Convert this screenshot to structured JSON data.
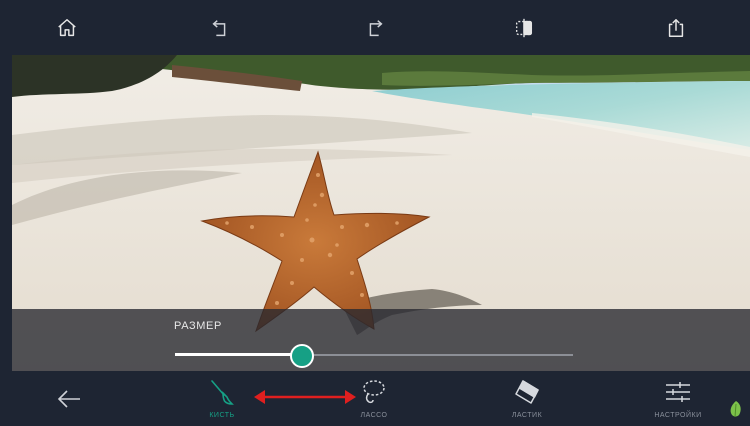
{
  "app": {
    "colors": {
      "background": "#1e2533",
      "accent": "#16a085",
      "arrow": "#e01f1f"
    }
  },
  "toolbar": {
    "buttons": [
      {
        "name": "home",
        "icon": "home-icon"
      },
      {
        "name": "undo",
        "icon": "undo-icon"
      },
      {
        "name": "redo",
        "icon": "redo-icon"
      },
      {
        "name": "compare",
        "icon": "compare-icon"
      },
      {
        "name": "share",
        "icon": "share-icon"
      }
    ]
  },
  "size_panel": {
    "label": "РАЗМЕР",
    "slider_value_percent": 32
  },
  "bottom_bar": {
    "back_icon": "arrow-left-icon",
    "tools": [
      {
        "label": "КИСТЬ",
        "icon": "brush-icon",
        "active": true
      },
      {
        "label": "ЛАССО",
        "icon": "lasso-icon",
        "active": false
      },
      {
        "label": "ЛАСТИК",
        "icon": "eraser-icon",
        "active": false
      },
      {
        "label": "НАСТРОЙКИ",
        "icon": "sliders-icon",
        "active": false
      }
    ]
  },
  "annotation": {
    "icon": "double-arrow-icon"
  }
}
